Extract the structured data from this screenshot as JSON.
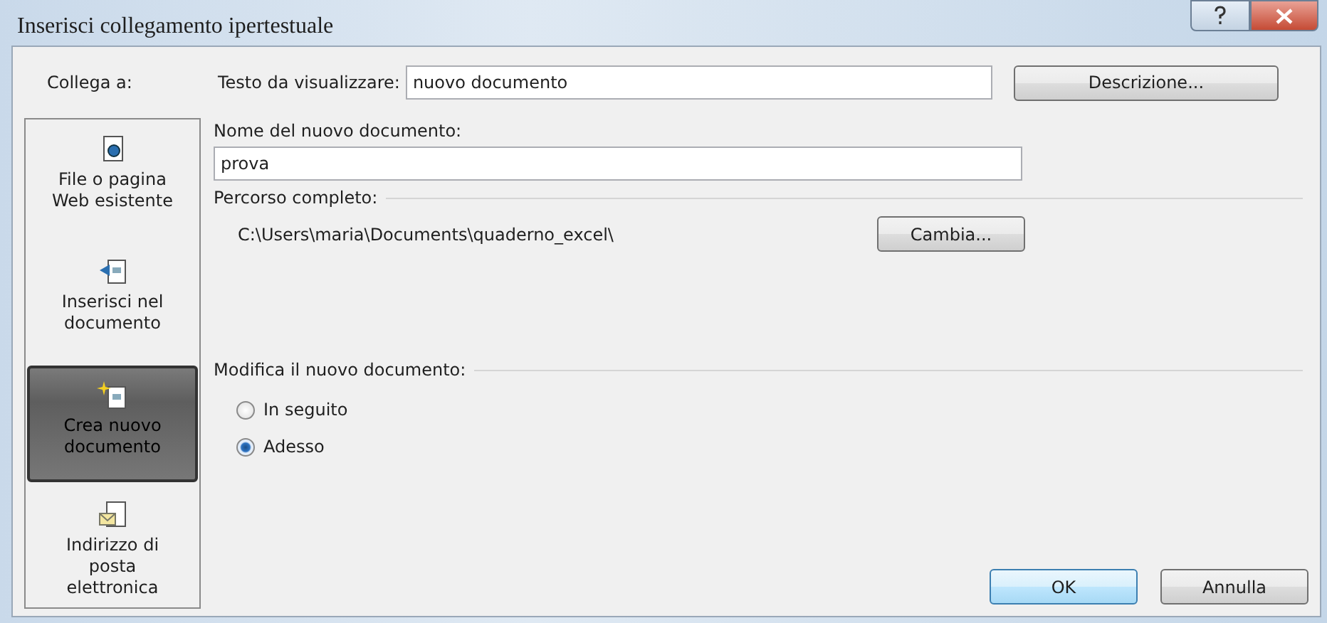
{
  "window": {
    "title": "Inserisci collegamento ipertestuale"
  },
  "link_to": {
    "label": "Collega a:"
  },
  "display_text": {
    "label": "Testo da visualizzare:",
    "value": "nuovo documento"
  },
  "description_button": "Descrizione...",
  "sidebar": {
    "items": [
      {
        "kind": "file",
        "label": "File o pagina Web esistente",
        "selected": false
      },
      {
        "kind": "place",
        "label": "Inserisci nel documento",
        "selected": false
      },
      {
        "kind": "new",
        "label": "Crea nuovo documento",
        "selected": true
      },
      {
        "kind": "mail",
        "label": "Indirizzo di posta elettronica",
        "selected": false
      }
    ]
  },
  "new_document": {
    "label": "Nome del nuovo documento:",
    "value": "prova"
  },
  "full_path": {
    "label": "Percorso completo:",
    "value": "C:\\Users\\maria\\Documents\\quaderno_excel\\",
    "button": "Cambia..."
  },
  "edit_when": {
    "label": "Modifica il nuovo documento:",
    "options": [
      {
        "label": "In seguito",
        "selected": false
      },
      {
        "label": "Adesso",
        "selected": true
      }
    ]
  },
  "buttons": [
    {
      "kind": "default",
      "label": "OK"
    },
    {
      "kind": "normal",
      "label": "Annulla"
    }
  ]
}
